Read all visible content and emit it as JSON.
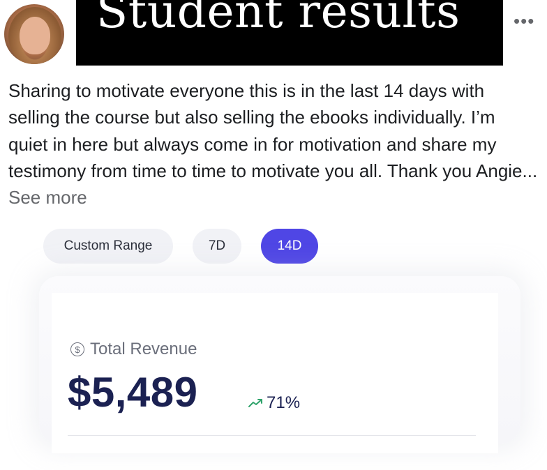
{
  "header": {
    "title": "Student results",
    "more_label": "•••"
  },
  "post": {
    "text": "Sharing to motivate everyone this is in the last 14 days with selling the course but also selling the ebooks individually. I’m quiet in here but always come in for motivation and share my testimony from time to time to motivate you all. Thank you Angie...",
    "see_more": "See more"
  },
  "range": {
    "options": [
      "Custom Range",
      "7D",
      "14D"
    ],
    "selected": "14D"
  },
  "revenue": {
    "label": "Total Revenue",
    "value": "$5,489",
    "change": "71%",
    "icon": "dollar-circle-icon",
    "trend_icon": "trend-up-icon"
  },
  "colors": {
    "accent": "#4f46e5",
    "value_text": "#1b2152",
    "trend": "#2fa36b"
  }
}
